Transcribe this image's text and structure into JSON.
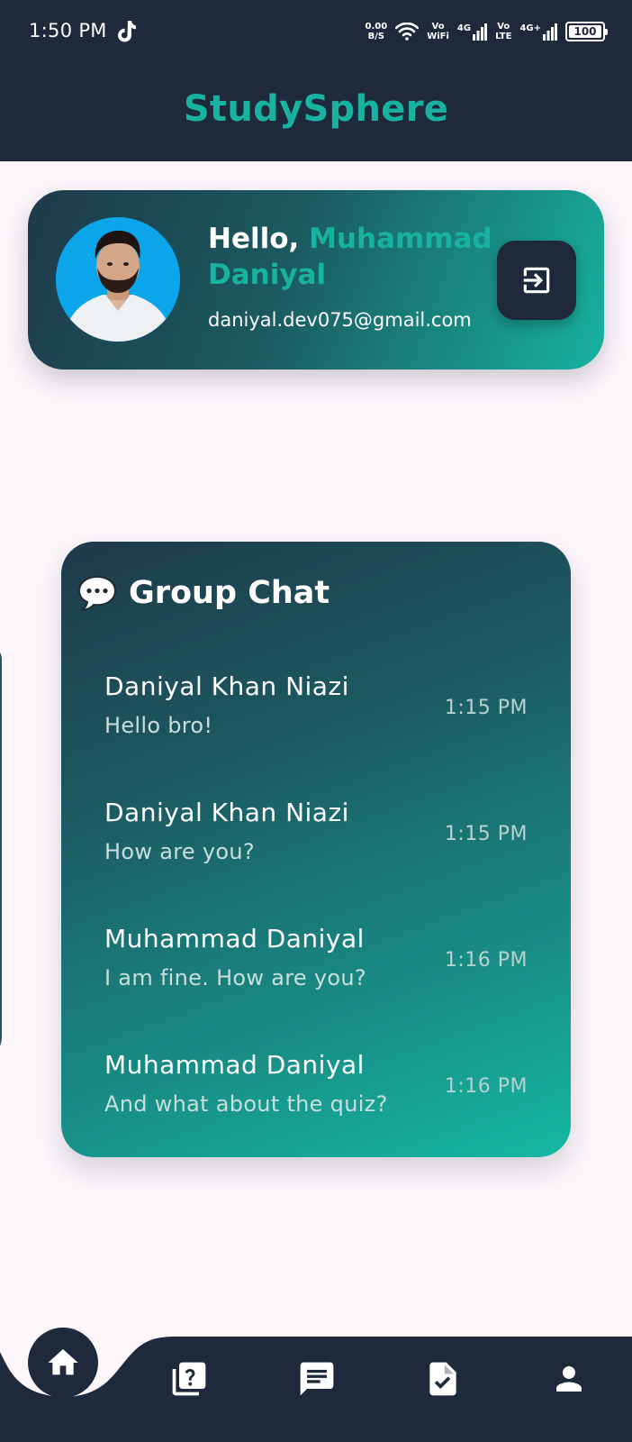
{
  "status_bar": {
    "time": "1:50 PM",
    "net_speed_value": "0.00",
    "net_speed_unit": "B/S",
    "vowifi_top": "Vo",
    "vowifi_bottom": "WiFi",
    "sim1_type": "4G",
    "volte_top": "Vo",
    "volte_bottom": "LTE",
    "sim2_type": "4G+",
    "battery": "100"
  },
  "app_bar": {
    "title": "StudySphere"
  },
  "profile": {
    "greeting": "Hello, ",
    "name": "Muhammad Daniyal",
    "email": "daniyal.dev075@gmail.com"
  },
  "group_chat": {
    "title": "Group Chat",
    "icon": "speech-bubble-icon",
    "messages": [
      {
        "sender": "Daniyal Khan Niazi",
        "text": "Hello bro!",
        "time": "1:15 PM"
      },
      {
        "sender": "Daniyal Khan Niazi",
        "text": "How are you?",
        "time": "1:15 PM"
      },
      {
        "sender": "Muhammad Daniyal",
        "text": "I am fine. How are you?",
        "time": "1:16 PM"
      },
      {
        "sender": "Muhammad Daniyal",
        "text": "And what about the quiz?",
        "time": "1:16 PM"
      }
    ]
  },
  "bottom_nav": {
    "items": [
      {
        "icon": "home-icon",
        "active": true
      },
      {
        "icon": "quiz-icon",
        "active": false
      },
      {
        "icon": "chat-icon",
        "active": false
      },
      {
        "icon": "assignment-icon",
        "active": false
      },
      {
        "icon": "person-icon",
        "active": false
      }
    ]
  },
  "colors": {
    "dark": "#1e293b",
    "accent": "#17b3a0",
    "background": "#fdf6fb"
  }
}
